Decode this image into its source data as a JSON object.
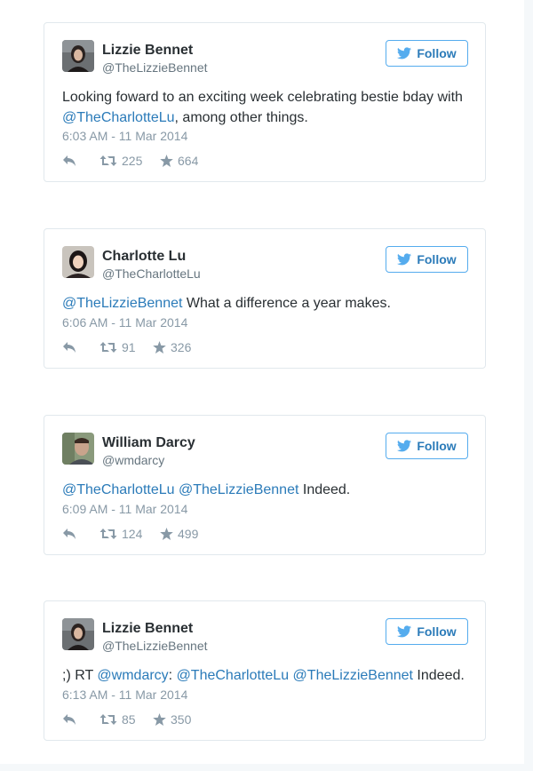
{
  "colors": {
    "link": "#2b7bb9",
    "follow_border": "#55acee",
    "meta": "#8899a6",
    "border": "#e1e8ed"
  },
  "tweets": [
    {
      "name": "Lizzie Bennet",
      "handle": "@TheLizzieBennet",
      "follow_label": "Follow",
      "text_parts": {
        "a": "Looking foward to an exciting week celebrating bestie bday with",
        "m1": "@TheCharlotteLu",
        "b": ", among other things."
      },
      "timestamp": "6:03 AM - 11 Mar 2014",
      "retweets": "225",
      "favorites": "664"
    },
    {
      "name": "Charlotte Lu",
      "handle": "@TheCharlotteLu",
      "follow_label": "Follow",
      "text_parts": {
        "m1": "@TheLizzieBennet",
        "b": " What a difference a year makes."
      },
      "timestamp": "6:06 AM - 11 Mar 2014",
      "retweets": "91",
      "favorites": "326"
    },
    {
      "name": "William Darcy",
      "handle": "@wmdarcy",
      "follow_label": "Follow",
      "text_parts": {
        "m1": "@TheCharlotteLu",
        "m2": "@TheLizzieBennet",
        "b": " Indeed."
      },
      "timestamp": "6:09 AM - 11 Mar 2014",
      "retweets": "124",
      "favorites": "499"
    },
    {
      "name": "Lizzie Bennet",
      "handle": "@TheLizzieBennet",
      "follow_label": "Follow",
      "text_parts": {
        "a": ";) RT ",
        "m1": "@wmdarcy",
        "c": ": ",
        "m2": "@TheCharlotteLu",
        "m3": "@TheLizzieBennet",
        "b": " Indeed."
      },
      "timestamp": "6:13 AM - 11 Mar 2014",
      "retweets": "85",
      "favorites": "350"
    }
  ],
  "icons": {
    "reply": "reply-icon",
    "retweet": "retweet-icon",
    "favorite": "star-icon",
    "follow": "twitter-bird-icon"
  }
}
